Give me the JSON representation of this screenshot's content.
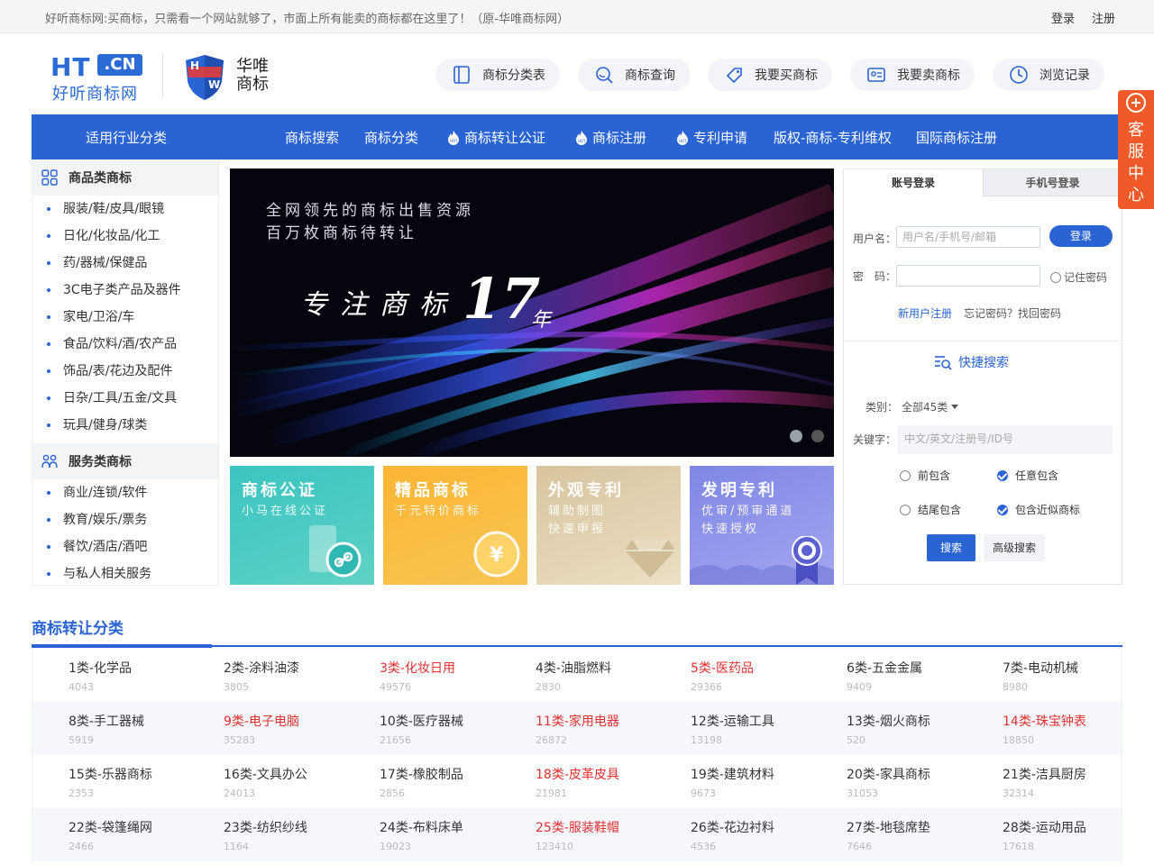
{
  "topbar": {
    "notice": "好听商标网:买商标，只需看一个网站就够了，市面上所有能卖的商标都在这里了！（原-华唯商标网）",
    "login": "登录",
    "register": "注册"
  },
  "logo": {
    "ht": "HT",
    "cn": ".CN",
    "sub": "好听商标网",
    "hw_line1": "华唯",
    "hw_line2": "商标",
    "hw_badge_h": "H",
    "hw_badge_w": "W"
  },
  "header_buttons": [
    {
      "label": "商标分类表",
      "icon": "book-icon"
    },
    {
      "label": "商标查询",
      "icon": "search-icon"
    },
    {
      "label": "我要买商标",
      "icon": "tag-icon"
    },
    {
      "label": "我要卖商标",
      "icon": "id-card-icon"
    },
    {
      "label": "浏览记录",
      "icon": "clock-icon"
    }
  ],
  "nav": {
    "category": "适用行业分类",
    "items": [
      {
        "label": "商标搜索",
        "hot": false
      },
      {
        "label": "商标分类",
        "hot": false
      },
      {
        "label": "商标转让公证",
        "hot": true
      },
      {
        "label": "商标注册",
        "hot": true
      },
      {
        "label": "专利申请",
        "hot": true
      },
      {
        "label": "版权-商标-专利维权",
        "hot": false
      },
      {
        "label": "国际商标注册",
        "hot": false
      }
    ]
  },
  "sidebar": {
    "goods_title": "商品类商标",
    "goods": [
      "服装/鞋/皮具/眼镜",
      "日化/化妆品/化工",
      "药/器械/保健品",
      "3C电子类产品及器件",
      "家电/卫浴/车",
      "食品/饮料/酒/农产品",
      "饰品/表/花边及配件",
      "日杂/工具/五金/文具",
      "玩具/健身/球类"
    ],
    "services_title": "服务类商标",
    "services": [
      "商业/连锁/软件",
      "教育/娱乐/票务",
      "餐饮/酒店/酒吧",
      "与私人相关服务"
    ]
  },
  "banner": {
    "line1": "全网领先的商标出售资源",
    "line2": "百万枚商标待转让",
    "slogan": "专注商标",
    "years": "17",
    "year_char": "年"
  },
  "tiles": [
    {
      "title": "商标公证",
      "sub1": "小马在线公证",
      "sub2": ""
    },
    {
      "title": "精品商标",
      "sub1": "千元特价商标",
      "sub2": ""
    },
    {
      "title": "外观专利",
      "sub1": "辅助制图",
      "sub2": "快速申报"
    },
    {
      "title": "发明专利",
      "sub1": "优审/预审通道",
      "sub2": "快速授权"
    }
  ],
  "login": {
    "tab_account": "账号登录",
    "tab_phone": "手机号登录",
    "username_label": "用户名：",
    "username_placeholder": "用户名/手机号/邮箱",
    "password_label": "密　码：",
    "login_button": "登录",
    "remember": "记住密码",
    "new_user": "新用户注册",
    "forgot": "忘记密码？找回密码"
  },
  "quick_search": {
    "title": "快捷搜索",
    "category_label": "类别：",
    "category_value": "全部45类",
    "keyword_label": "关键字：",
    "keyword_placeholder": "中文/英文/注册号/ID号",
    "options": [
      {
        "label": "前包含",
        "checked": false
      },
      {
        "label": "任意包含",
        "checked": true
      },
      {
        "label": "结尾包含",
        "checked": false
      },
      {
        "label": "包含近似商标",
        "checked": true
      }
    ],
    "search_button": "搜索",
    "advanced_button": "高级搜索"
  },
  "kefu": {
    "label": "客服中心"
  },
  "category_section": {
    "title": "商标转让分类",
    "rows": [
      [
        {
          "name": "1类-化学品",
          "count": "4043",
          "hot": false
        },
        {
          "name": "2类-涂料油漆",
          "count": "3805",
          "hot": false
        },
        {
          "name": "3类-化妆日用",
          "count": "49576",
          "hot": true
        },
        {
          "name": "4类-油脂燃料",
          "count": "2830",
          "hot": false
        },
        {
          "name": "5类-医药品",
          "count": "29366",
          "hot": true
        },
        {
          "name": "6类-五金金属",
          "count": "9409",
          "hot": false
        },
        {
          "name": "7类-电动机械",
          "count": "8980",
          "hot": false
        }
      ],
      [
        {
          "name": "8类-手工器械",
          "count": "5919",
          "hot": false
        },
        {
          "name": "9类-电子电脑",
          "count": "35283",
          "hot": true
        },
        {
          "name": "10类-医疗器械",
          "count": "21656",
          "hot": false
        },
        {
          "name": "11类-家用电器",
          "count": "26872",
          "hot": true
        },
        {
          "name": "12类-运输工具",
          "count": "13198",
          "hot": false
        },
        {
          "name": "13类-烟火商标",
          "count": "520",
          "hot": false
        },
        {
          "name": "14类-珠宝钟表",
          "count": "18850",
          "hot": true
        }
      ],
      [
        {
          "name": "15类-乐器商标",
          "count": "2353",
          "hot": false
        },
        {
          "name": "16类-文具办公",
          "count": "24013",
          "hot": false
        },
        {
          "name": "17类-橡胶制品",
          "count": "2856",
          "hot": false
        },
        {
          "name": "18类-皮革皮具",
          "count": "21981",
          "hot": true
        },
        {
          "name": "19类-建筑材料",
          "count": "9673",
          "hot": false
        },
        {
          "name": "20类-家具商标",
          "count": "31053",
          "hot": false
        },
        {
          "name": "21类-洁具厨房",
          "count": "32314",
          "hot": false
        }
      ],
      [
        {
          "name": "22类-袋篷绳网",
          "count": "2466",
          "hot": false
        },
        {
          "name": "23类-纺织纱线",
          "count": "1164",
          "hot": false
        },
        {
          "name": "24类-布料床单",
          "count": "19023",
          "hot": false
        },
        {
          "name": "25类-服装鞋帽",
          "count": "123410",
          "hot": true
        },
        {
          "name": "26类-花边衬料",
          "count": "4536",
          "hot": false
        },
        {
          "name": "27类-地毯席垫",
          "count": "7646",
          "hot": false
        },
        {
          "name": "28类-运动用品",
          "count": "17618",
          "hot": false
        }
      ]
    ]
  }
}
